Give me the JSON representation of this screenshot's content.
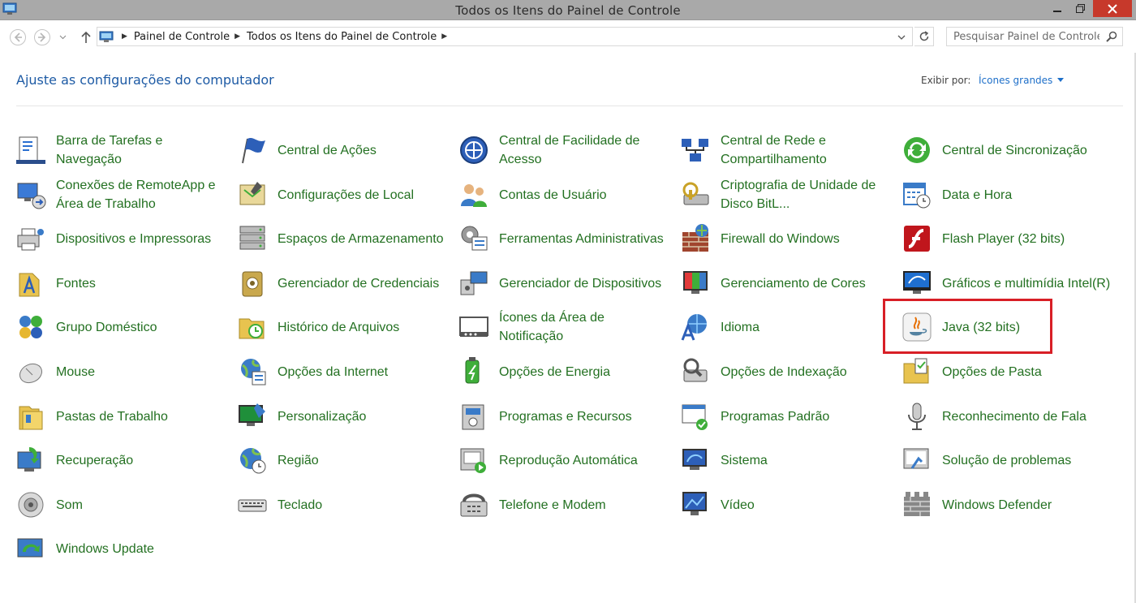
{
  "window": {
    "title": "Todos os Itens do Painel de Controle"
  },
  "address": {
    "crumbs": [
      "Painel de Controle",
      "Todos os Itens do Painel de Controle"
    ],
    "search_placeholder": "Pesquisar Painel de Controle"
  },
  "header": {
    "title": "Ajuste as configurações do computador",
    "view_by_label": "Exibir por:",
    "view_by_value": "Ícones grandes"
  },
  "items": [
    {
      "label": "Barra de Tarefas e Navegação",
      "icon": "taskbar-icon"
    },
    {
      "label": "Central de Ações",
      "icon": "flag-icon"
    },
    {
      "label": "Central de Facilidade de Acesso",
      "icon": "ease-of-access-icon"
    },
    {
      "label": "Central de Rede e Compartilhamento",
      "icon": "network-icon"
    },
    {
      "label": "Central de Sincronização",
      "icon": "sync-icon"
    },
    {
      "label": "Conexões de RemoteApp e Área de Trabalho",
      "icon": "remoteapp-icon"
    },
    {
      "label": "Configurações de Local",
      "icon": "location-icon"
    },
    {
      "label": "Contas de Usuário",
      "icon": "users-icon"
    },
    {
      "label": "Criptografia de Unidade de Disco BitL...",
      "icon": "bitlocker-icon"
    },
    {
      "label": "Data e Hora",
      "icon": "calendar-clock-icon"
    },
    {
      "label": "Dispositivos e Impressoras",
      "icon": "printer-icon"
    },
    {
      "label": "Espaços de Armazenamento",
      "icon": "storage-icon"
    },
    {
      "label": "Ferramentas Administrativas",
      "icon": "admin-tools-icon"
    },
    {
      "label": "Firewall do Windows",
      "icon": "firewall-icon"
    },
    {
      "label": "Flash Player (32 bits)",
      "icon": "flash-icon"
    },
    {
      "label": "Fontes",
      "icon": "fonts-icon"
    },
    {
      "label": "Gerenciador de Credenciais",
      "icon": "credential-icon"
    },
    {
      "label": "Gerenciador de Dispositivos",
      "icon": "device-manager-icon"
    },
    {
      "label": "Gerenciamento de Cores",
      "icon": "color-management-icon"
    },
    {
      "label": "Gráficos e multimídia Intel(R)",
      "icon": "intel-graphics-icon"
    },
    {
      "label": "Grupo Doméstico",
      "icon": "homegroup-icon"
    },
    {
      "label": "Histórico de Arquivos",
      "icon": "file-history-icon"
    },
    {
      "label": "Ícones da Área de Notificação",
      "icon": "notification-icon"
    },
    {
      "label": "Idioma",
      "icon": "language-icon"
    },
    {
      "label": "Java (32 bits)",
      "icon": "java-icon"
    },
    {
      "label": "Mouse",
      "icon": "mouse-icon"
    },
    {
      "label": "Opções da Internet",
      "icon": "internet-options-icon"
    },
    {
      "label": "Opções de Energia",
      "icon": "power-icon"
    },
    {
      "label": "Opções de Indexação",
      "icon": "indexing-icon"
    },
    {
      "label": "Opções de Pasta",
      "icon": "folder-options-icon"
    },
    {
      "label": "Pastas de Trabalho",
      "icon": "work-folders-icon"
    },
    {
      "label": "Personalização",
      "icon": "personalization-icon"
    },
    {
      "label": "Programas e Recursos",
      "icon": "programs-icon"
    },
    {
      "label": "Programas Padrão",
      "icon": "default-programs-icon"
    },
    {
      "label": "Reconhecimento de Fala",
      "icon": "microphone-icon"
    },
    {
      "label": "Recuperação",
      "icon": "recovery-icon"
    },
    {
      "label": "Região",
      "icon": "region-icon"
    },
    {
      "label": "Reprodução Automática",
      "icon": "autoplay-icon"
    },
    {
      "label": "Sistema",
      "icon": "system-icon"
    },
    {
      "label": "Solução de problemas",
      "icon": "troubleshoot-icon"
    },
    {
      "label": "Som",
      "icon": "speaker-icon"
    },
    {
      "label": "Teclado",
      "icon": "keyboard-icon"
    },
    {
      "label": "Telefone e Modem",
      "icon": "phone-modem-icon"
    },
    {
      "label": "Vídeo",
      "icon": "display-icon"
    },
    {
      "label": "Windows Defender",
      "icon": "defender-icon"
    },
    {
      "label": "Windows Update",
      "icon": "windows-update-icon"
    }
  ],
  "colors": {
    "link_green": "#237021",
    "heading_blue": "#1e5ba5",
    "highlight_red": "#d81f26"
  }
}
